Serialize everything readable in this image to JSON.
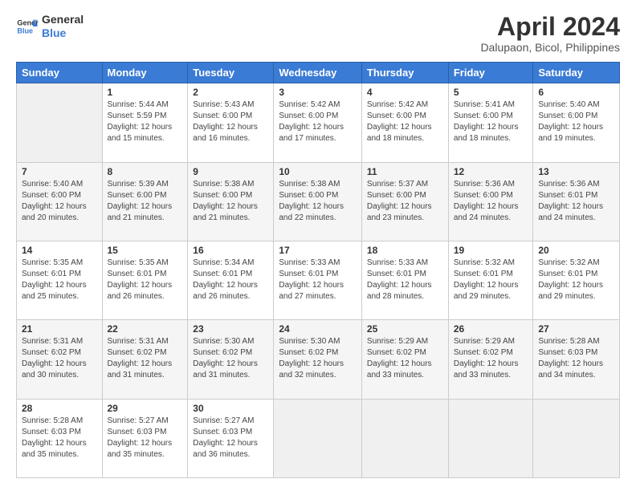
{
  "logo": {
    "line1": "General",
    "line2": "Blue"
  },
  "title": "April 2024",
  "subtitle": "Dalupaon, Bicol, Philippines",
  "headers": [
    "Sunday",
    "Monday",
    "Tuesday",
    "Wednesday",
    "Thursday",
    "Friday",
    "Saturday"
  ],
  "weeks": [
    [
      {
        "day": "",
        "sunrise": "",
        "sunset": "",
        "daylight": ""
      },
      {
        "day": "1",
        "sunrise": "Sunrise: 5:44 AM",
        "sunset": "Sunset: 5:59 PM",
        "daylight": "Daylight: 12 hours and 15 minutes."
      },
      {
        "day": "2",
        "sunrise": "Sunrise: 5:43 AM",
        "sunset": "Sunset: 6:00 PM",
        "daylight": "Daylight: 12 hours and 16 minutes."
      },
      {
        "day": "3",
        "sunrise": "Sunrise: 5:42 AM",
        "sunset": "Sunset: 6:00 PM",
        "daylight": "Daylight: 12 hours and 17 minutes."
      },
      {
        "day": "4",
        "sunrise": "Sunrise: 5:42 AM",
        "sunset": "Sunset: 6:00 PM",
        "daylight": "Daylight: 12 hours and 18 minutes."
      },
      {
        "day": "5",
        "sunrise": "Sunrise: 5:41 AM",
        "sunset": "Sunset: 6:00 PM",
        "daylight": "Daylight: 12 hours and 18 minutes."
      },
      {
        "day": "6",
        "sunrise": "Sunrise: 5:40 AM",
        "sunset": "Sunset: 6:00 PM",
        "daylight": "Daylight: 12 hours and 19 minutes."
      }
    ],
    [
      {
        "day": "7",
        "sunrise": "Sunrise: 5:40 AM",
        "sunset": "Sunset: 6:00 PM",
        "daylight": "Daylight: 12 hours and 20 minutes."
      },
      {
        "day": "8",
        "sunrise": "Sunrise: 5:39 AM",
        "sunset": "Sunset: 6:00 PM",
        "daylight": "Daylight: 12 hours and 21 minutes."
      },
      {
        "day": "9",
        "sunrise": "Sunrise: 5:38 AM",
        "sunset": "Sunset: 6:00 PM",
        "daylight": "Daylight: 12 hours and 21 minutes."
      },
      {
        "day": "10",
        "sunrise": "Sunrise: 5:38 AM",
        "sunset": "Sunset: 6:00 PM",
        "daylight": "Daylight: 12 hours and 22 minutes."
      },
      {
        "day": "11",
        "sunrise": "Sunrise: 5:37 AM",
        "sunset": "Sunset: 6:00 PM",
        "daylight": "Daylight: 12 hours and 23 minutes."
      },
      {
        "day": "12",
        "sunrise": "Sunrise: 5:36 AM",
        "sunset": "Sunset: 6:00 PM",
        "daylight": "Daylight: 12 hours and 24 minutes."
      },
      {
        "day": "13",
        "sunrise": "Sunrise: 5:36 AM",
        "sunset": "Sunset: 6:01 PM",
        "daylight": "Daylight: 12 hours and 24 minutes."
      }
    ],
    [
      {
        "day": "14",
        "sunrise": "Sunrise: 5:35 AM",
        "sunset": "Sunset: 6:01 PM",
        "daylight": "Daylight: 12 hours and 25 minutes."
      },
      {
        "day": "15",
        "sunrise": "Sunrise: 5:35 AM",
        "sunset": "Sunset: 6:01 PM",
        "daylight": "Daylight: 12 hours and 26 minutes."
      },
      {
        "day": "16",
        "sunrise": "Sunrise: 5:34 AM",
        "sunset": "Sunset: 6:01 PM",
        "daylight": "Daylight: 12 hours and 26 minutes."
      },
      {
        "day": "17",
        "sunrise": "Sunrise: 5:33 AM",
        "sunset": "Sunset: 6:01 PM",
        "daylight": "Daylight: 12 hours and 27 minutes."
      },
      {
        "day": "18",
        "sunrise": "Sunrise: 5:33 AM",
        "sunset": "Sunset: 6:01 PM",
        "daylight": "Daylight: 12 hours and 28 minutes."
      },
      {
        "day": "19",
        "sunrise": "Sunrise: 5:32 AM",
        "sunset": "Sunset: 6:01 PM",
        "daylight": "Daylight: 12 hours and 29 minutes."
      },
      {
        "day": "20",
        "sunrise": "Sunrise: 5:32 AM",
        "sunset": "Sunset: 6:01 PM",
        "daylight": "Daylight: 12 hours and 29 minutes."
      }
    ],
    [
      {
        "day": "21",
        "sunrise": "Sunrise: 5:31 AM",
        "sunset": "Sunset: 6:02 PM",
        "daylight": "Daylight: 12 hours and 30 minutes."
      },
      {
        "day": "22",
        "sunrise": "Sunrise: 5:31 AM",
        "sunset": "Sunset: 6:02 PM",
        "daylight": "Daylight: 12 hours and 31 minutes."
      },
      {
        "day": "23",
        "sunrise": "Sunrise: 5:30 AM",
        "sunset": "Sunset: 6:02 PM",
        "daylight": "Daylight: 12 hours and 31 minutes."
      },
      {
        "day": "24",
        "sunrise": "Sunrise: 5:30 AM",
        "sunset": "Sunset: 6:02 PM",
        "daylight": "Daylight: 12 hours and 32 minutes."
      },
      {
        "day": "25",
        "sunrise": "Sunrise: 5:29 AM",
        "sunset": "Sunset: 6:02 PM",
        "daylight": "Daylight: 12 hours and 33 minutes."
      },
      {
        "day": "26",
        "sunrise": "Sunrise: 5:29 AM",
        "sunset": "Sunset: 6:02 PM",
        "daylight": "Daylight: 12 hours and 33 minutes."
      },
      {
        "day": "27",
        "sunrise": "Sunrise: 5:28 AM",
        "sunset": "Sunset: 6:03 PM",
        "daylight": "Daylight: 12 hours and 34 minutes."
      }
    ],
    [
      {
        "day": "28",
        "sunrise": "Sunrise: 5:28 AM",
        "sunset": "Sunset: 6:03 PM",
        "daylight": "Daylight: 12 hours and 35 minutes."
      },
      {
        "day": "29",
        "sunrise": "Sunrise: 5:27 AM",
        "sunset": "Sunset: 6:03 PM",
        "daylight": "Daylight: 12 hours and 35 minutes."
      },
      {
        "day": "30",
        "sunrise": "Sunrise: 5:27 AM",
        "sunset": "Sunset: 6:03 PM",
        "daylight": "Daylight: 12 hours and 36 minutes."
      },
      {
        "day": "",
        "sunrise": "",
        "sunset": "",
        "daylight": ""
      },
      {
        "day": "",
        "sunrise": "",
        "sunset": "",
        "daylight": ""
      },
      {
        "day": "",
        "sunrise": "",
        "sunset": "",
        "daylight": ""
      },
      {
        "day": "",
        "sunrise": "",
        "sunset": "",
        "daylight": ""
      }
    ]
  ]
}
